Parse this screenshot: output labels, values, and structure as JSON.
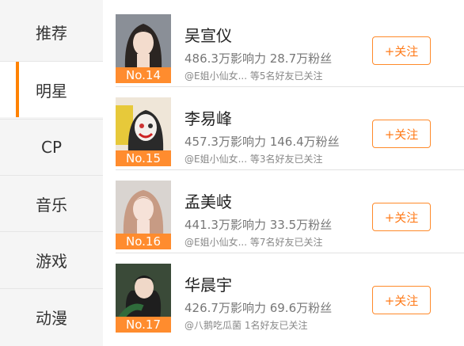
{
  "sidebar": {
    "items": [
      {
        "label": "推荐"
      },
      {
        "label": "明星"
      },
      {
        "label": "CP"
      },
      {
        "label": "音乐"
      },
      {
        "label": "游戏"
      },
      {
        "label": "动漫"
      }
    ],
    "active": "明星"
  },
  "stars": [
    {
      "name": "吴宣仪",
      "rank": "No.14",
      "stats": "486.3万影响力  28.7万粉丝",
      "friends": "@E姐小仙女... 等5名好友已关注",
      "follow_label": "+关注"
    },
    {
      "name": "李易峰",
      "rank": "No.15",
      "stats": "457.3万影响力  146.4万粉丝",
      "friends": "@E姐小仙女... 等3名好友已关注",
      "follow_label": "+关注"
    },
    {
      "name": "孟美岐",
      "rank": "No.16",
      "stats": "441.3万影响力  33.5万粉丝",
      "friends": "@E姐小仙女... 等7名好友已关注",
      "follow_label": "+关注"
    },
    {
      "name": "华晨宇",
      "rank": "No.17",
      "stats": "426.7万影响力  69.6万粉丝",
      "friends": "@八鹅吃瓜菌 1名好友已关注",
      "follow_label": "+关注"
    }
  ],
  "colors": {
    "accent": "#ff8200",
    "rank_badge": "#ff8c2e"
  }
}
